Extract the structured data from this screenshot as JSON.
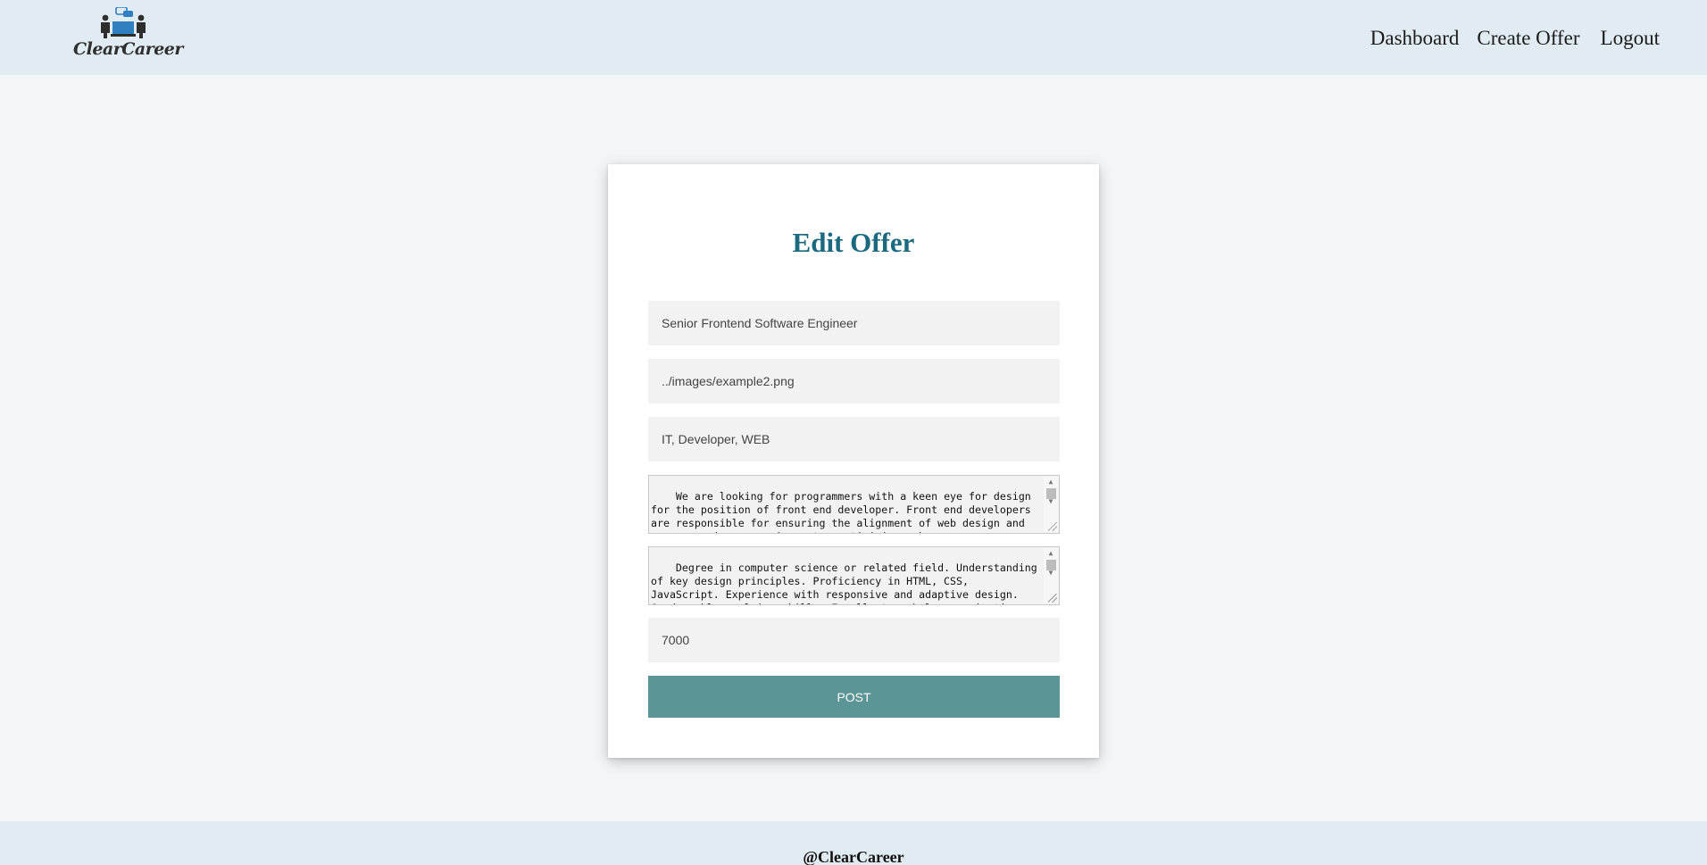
{
  "header": {
    "brand": "ClearCareer",
    "nav": [
      {
        "label": "Dashboard"
      },
      {
        "label": "Create Offer"
      },
      {
        "label": "Logout"
      }
    ]
  },
  "form": {
    "title": "Edit Offer",
    "title_color": "#1b6a80",
    "job_title_value": "Senior Frontend Software Engineer",
    "image_value": "../images/example2.png",
    "tags_value": "IT, Developer, WEB",
    "description_value": "We are looking for programmers with a keen eye for design for the position of front end developer. Front end developers are responsible for ensuring the alignment of web design and user experience requirements, optimizing web",
    "requirements_value": "Degree in computer science or related field. Understanding of key design principles. Proficiency in HTML, CSS, JavaScript. Experience with responsive and adaptive design. Good problem-solving skills. Excellent verbal communication",
    "salary_value": "7000",
    "submit_label": "POST",
    "submit_color": "#5b9595"
  },
  "footer": {
    "text": "@ClearCareer"
  },
  "colors": {
    "header_bg": "#e1ebf2",
    "page_bg": "#f2f6f7",
    "logo_blue": "#2f7fc1"
  }
}
